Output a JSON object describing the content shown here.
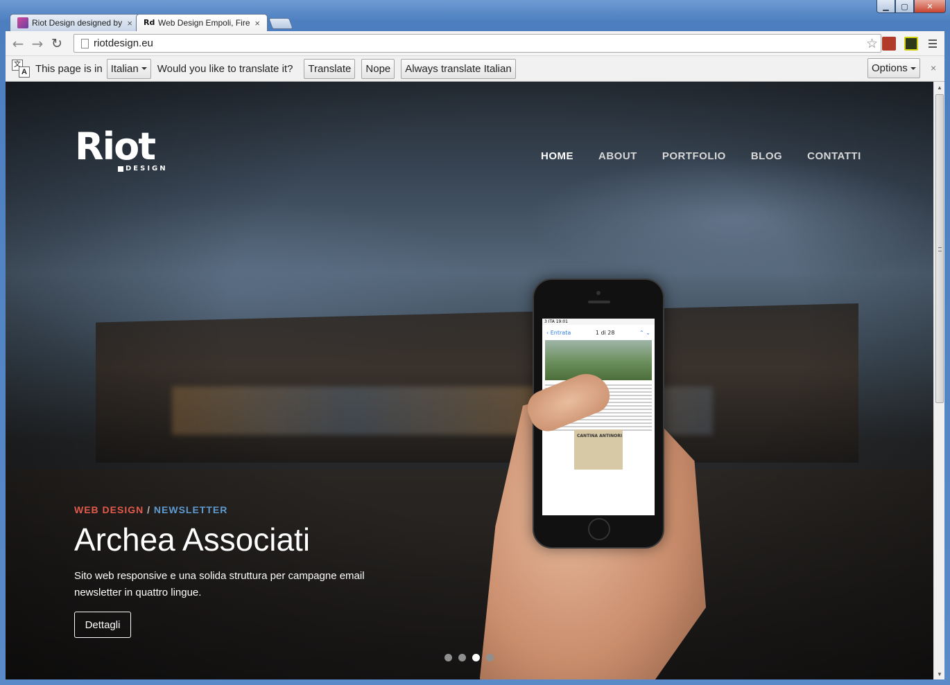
{
  "window": {
    "controls": {
      "minimize": "▁",
      "maximize": "▢",
      "close": "✕"
    }
  },
  "tabs": [
    {
      "title": "Riot Design designed by R",
      "close": "×",
      "favicon_color": "#6b3fa0"
    },
    {
      "title": "Web Design Empoli, Firenze",
      "close": "×",
      "active": true
    }
  ],
  "toolbar": {
    "back": "←",
    "forward": "→",
    "reload": "↻",
    "url": "riotdesign.eu",
    "star": "☆"
  },
  "translate_bar": {
    "text_before": "This page is in",
    "language": "Italian",
    "question": "Would you like to translate it?",
    "translate_label": "Translate",
    "nope_label": "Nope",
    "always_label": "Always translate Italian",
    "options_label": "Options",
    "close": "×",
    "icon_a": "文",
    "icon_b": "A"
  },
  "site": {
    "logo_main": "Riot",
    "logo_sub": "DESIGN",
    "nav": [
      {
        "label": "HOME",
        "active": true
      },
      {
        "label": "ABOUT"
      },
      {
        "label": "PORTFOLIO"
      },
      {
        "label": "BLOG"
      },
      {
        "label": "CONTATTI"
      }
    ],
    "slide": {
      "category_1": "WEB DESIGN",
      "separator": "/",
      "category_2": "NEWSLETTER",
      "title": "Archea Associati",
      "description": "Sito web responsive e una solida struttura per campagne email newsletter in quattro lingue.",
      "button": "Dettagli"
    },
    "slides_total": 4,
    "slides_active_index": 2,
    "phone": {
      "status": "3 ITA   19:01",
      "back": "‹ Entrata",
      "counter": "1 di 28",
      "card_title": "CANTINA ANTINORI"
    }
  },
  "colors": {
    "accent_red": "#e15a4b",
    "accent_blue": "#5f9bd0"
  }
}
